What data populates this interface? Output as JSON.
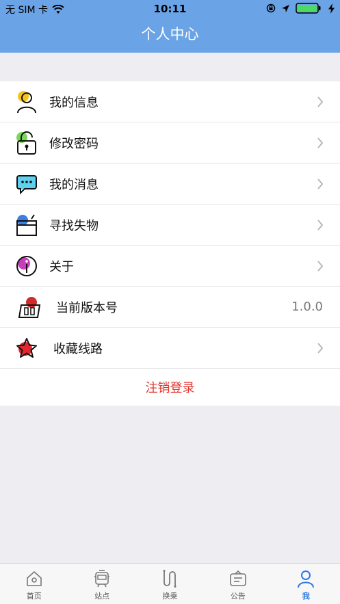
{
  "status_bar": {
    "carrier": "无 SIM 卡",
    "time": "10:11"
  },
  "header": {
    "title": "个人中心"
  },
  "menu": {
    "items": [
      {
        "label": "我的信息",
        "icon": "user-icon"
      },
      {
        "label": "修改密码",
        "icon": "lock-icon"
      },
      {
        "label": "我的消息",
        "icon": "message-icon"
      },
      {
        "label": "寻找失物",
        "icon": "lost-item-box-icon"
      },
      {
        "label": "关于",
        "icon": "info-icon"
      },
      {
        "label": "当前版本号",
        "icon": "version-icon",
        "value": "1.0.0"
      },
      {
        "label": "收藏线路",
        "icon": "star-icon"
      }
    ],
    "logout_label": "注销登录"
  },
  "tabbar": {
    "tabs": [
      {
        "label": "首页",
        "icon": "home-icon"
      },
      {
        "label": "站点",
        "icon": "station-icon"
      },
      {
        "label": "换乘",
        "icon": "transfer-icon"
      },
      {
        "label": "公告",
        "icon": "notice-icon"
      },
      {
        "label": "我",
        "icon": "profile-icon",
        "active": true
      }
    ]
  },
  "colors": {
    "header_bg": "#6aa3e6",
    "logout_text": "#e5332a",
    "active_tab": "#2a7be4"
  }
}
